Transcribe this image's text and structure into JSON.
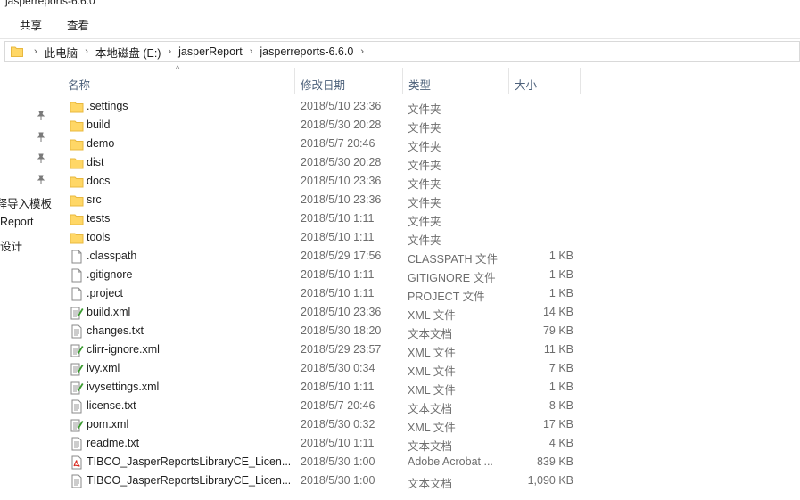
{
  "window": {
    "title": "jasperreports-6.6.0"
  },
  "ribbon": {
    "tabs": [
      "共享",
      "查看"
    ]
  },
  "address": {
    "crumbs": [
      "此电脑",
      "本地磁盘 (E:)",
      "jasperReport",
      "jasperreports-6.6.0"
    ],
    "expand_glyph": "›"
  },
  "nav": {
    "pinned_count": 4,
    "items": [
      "注释导入模板",
      "Report",
      "设计"
    ]
  },
  "columns": {
    "name": "名称",
    "date": "修改日期",
    "type": "类型",
    "size": "大小",
    "sort_glyph": "^"
  },
  "colors": {
    "folder": "#ffd766",
    "folder_dark": "#e8b83f",
    "header_text": "#4c607a",
    "meta_text": "#6d6d6d",
    "pdf_red": "#d9261c",
    "xml_green": "#3a9b2f"
  },
  "files": [
    {
      "icon": "folder-icon",
      "name": ".settings",
      "date": "2018/5/10 23:36",
      "type": "文件夹",
      "size": ""
    },
    {
      "icon": "folder-icon",
      "name": "build",
      "date": "2018/5/30 20:28",
      "type": "文件夹",
      "size": ""
    },
    {
      "icon": "folder-icon",
      "name": "demo",
      "date": "2018/5/7 20:46",
      "type": "文件夹",
      "size": ""
    },
    {
      "icon": "folder-icon",
      "name": "dist",
      "date": "2018/5/30 20:28",
      "type": "文件夹",
      "size": ""
    },
    {
      "icon": "folder-icon",
      "name": "docs",
      "date": "2018/5/10 23:36",
      "type": "文件夹",
      "size": ""
    },
    {
      "icon": "folder-icon",
      "name": "src",
      "date": "2018/5/10 23:36",
      "type": "文件夹",
      "size": ""
    },
    {
      "icon": "folder-icon",
      "name": "tests",
      "date": "2018/5/10 1:11",
      "type": "文件夹",
      "size": ""
    },
    {
      "icon": "folder-icon",
      "name": "tools",
      "date": "2018/5/10 1:11",
      "type": "文件夹",
      "size": ""
    },
    {
      "icon": "file-icon",
      "name": ".classpath",
      "date": "2018/5/29 17:56",
      "type": "CLASSPATH 文件",
      "size": "1 KB"
    },
    {
      "icon": "file-icon",
      "name": ".gitignore",
      "date": "2018/5/10 1:11",
      "type": "GITIGNORE 文件",
      "size": "1 KB"
    },
    {
      "icon": "file-icon",
      "name": ".project",
      "date": "2018/5/10 1:11",
      "type": "PROJECT 文件",
      "size": "1 KB"
    },
    {
      "icon": "xml-file-icon",
      "name": "build.xml",
      "date": "2018/5/10 23:36",
      "type": "XML 文件",
      "size": "14 KB"
    },
    {
      "icon": "text-file-icon",
      "name": "changes.txt",
      "date": "2018/5/30 18:20",
      "type": "文本文档",
      "size": "79 KB"
    },
    {
      "icon": "xml-file-icon",
      "name": "clirr-ignore.xml",
      "date": "2018/5/29 23:57",
      "type": "XML 文件",
      "size": "11 KB"
    },
    {
      "icon": "xml-file-icon",
      "name": "ivy.xml",
      "date": "2018/5/30 0:34",
      "type": "XML 文件",
      "size": "7 KB"
    },
    {
      "icon": "xml-file-icon",
      "name": "ivysettings.xml",
      "date": "2018/5/10 1:11",
      "type": "XML 文件",
      "size": "1 KB"
    },
    {
      "icon": "text-file-icon",
      "name": "license.txt",
      "date": "2018/5/7 20:46",
      "type": "文本文档",
      "size": "8 KB"
    },
    {
      "icon": "xml-file-icon",
      "name": "pom.xml",
      "date": "2018/5/30 0:32",
      "type": "XML 文件",
      "size": "17 KB"
    },
    {
      "icon": "text-file-icon",
      "name": "readme.txt",
      "date": "2018/5/10 1:11",
      "type": "文本文档",
      "size": "4 KB"
    },
    {
      "icon": "pdf-file-icon",
      "name": "TIBCO_JasperReportsLibraryCE_Licen...",
      "date": "2018/5/30 1:00",
      "type": "Adobe Acrobat ...",
      "size": "839 KB"
    },
    {
      "icon": "text-file-icon",
      "name": "TIBCO_JasperReportsLibraryCE_Licen...",
      "date": "2018/5/30 1:00",
      "type": "文本文档",
      "size": "1,090 KB"
    }
  ]
}
